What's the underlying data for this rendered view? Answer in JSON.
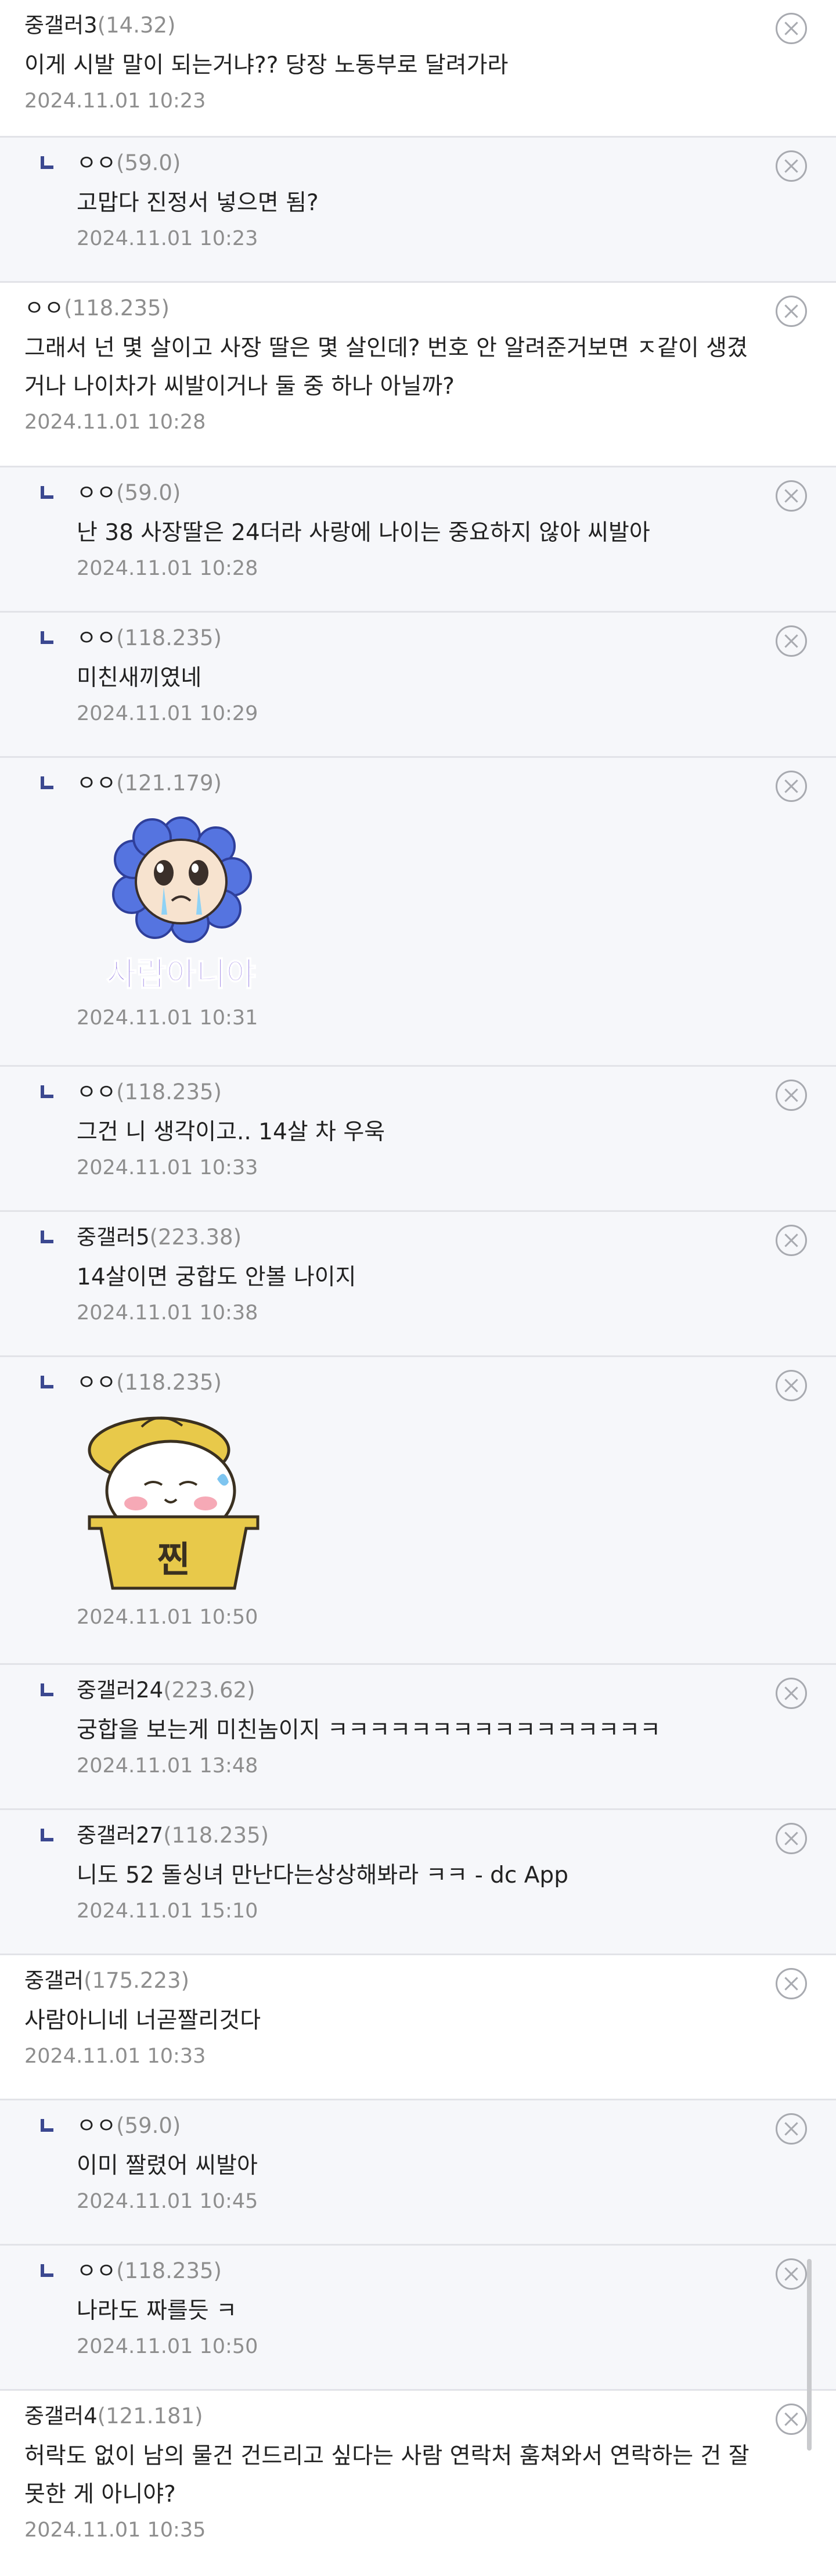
{
  "comments": [
    {
      "type": "comment",
      "nick": "중갤러3",
      "ip": "(14.32)",
      "text": "이게 시발 말이 되는거냐?? 당장 노동부로 달려가라",
      "date": "2024.11.01 10:23"
    },
    {
      "type": "reply",
      "nick": "ㅇㅇ",
      "ip": "(59.0)",
      "text": "고맙다 진정서 넣으면 됨?",
      "date": "2024.11.01 10:23"
    },
    {
      "type": "comment",
      "nick": "ㅇㅇ",
      "ip": "(118.235)",
      "text": "그래서 넌 몇 살이고 사장 딸은 몇 살인데? 번호 안 알려준거보면 ㅈ같이 생겼거나 나이차가 씨발이거나 둘 중 하나 아닐까?",
      "date": "2024.11.01 10:28"
    },
    {
      "type": "reply",
      "nick": "ㅇㅇ",
      "ip": "(59.0)",
      "text": "난 38 사장딸은 24더라 사랑에 나이는 중요하지 않아 씨발아",
      "date": "2024.11.01 10:28"
    },
    {
      "type": "reply",
      "nick": "ㅇㅇ",
      "ip": "(118.235)",
      "text": "미친새끼였네",
      "date": "2024.11.01 10:29"
    },
    {
      "type": "reply",
      "nick": "ㅇㅇ",
      "ip": "(121.179)",
      "sticker": "crying-flower-sticker",
      "sticker_text": "사람아니야",
      "date": "2024.11.01 10:31"
    },
    {
      "type": "reply",
      "nick": "ㅇㅇ",
      "ip": "(118.235)",
      "text": "그건 니 생각이고.. 14살 차 우욱",
      "date": "2024.11.01 10:33"
    },
    {
      "type": "reply",
      "nick": "중갤러5",
      "ip": "(223.38)",
      "text": "14살이면 궁합도 안볼 나이지",
      "date": "2024.11.01 10:38"
    },
    {
      "type": "reply",
      "nick": "ㅇㅇ",
      "ip": "(118.235)",
      "sticker": "steamed-bun-sticker",
      "sticker_text": "찐",
      "date": "2024.11.01 10:50"
    },
    {
      "type": "reply",
      "nick": "중갤러24",
      "ip": "(223.62)",
      "text": "궁합을 보는게 미친놈이지 ㅋㅋㅋㅋㅋㅋㅋㅋㅋㅋㅋㅋㅋㅋㅋㅋ",
      "date": "2024.11.01 13:48"
    },
    {
      "type": "reply",
      "nick": "중갤러27",
      "ip": "(118.235)",
      "text": "니도 52 돌싱녀 만난다는상상해봐라 ㅋㅋ - dc App",
      "date": "2024.11.01 15:10"
    },
    {
      "type": "comment",
      "nick": "중갤러",
      "ip": "(175.223)",
      "text": "사람아니네 너곧짤리것다",
      "date": "2024.11.01 10:33"
    },
    {
      "type": "reply",
      "nick": "ㅇㅇ",
      "ip": "(59.0)",
      "text": "이미 짤렸어 씨발아",
      "date": "2024.11.01 10:45"
    },
    {
      "type": "reply",
      "nick": "ㅇㅇ",
      "ip": "(118.235)",
      "text": "나라도 짜를듯 ㅋ",
      "date": "2024.11.01 10:50"
    },
    {
      "type": "comment",
      "nick": "중갤러4",
      "ip": "(121.181)",
      "text": "허락도 없이 남의 물건 건드리고 싶다는 사람 연락처 훔쳐와서 연락하는 건 잘못한 게 아니야?",
      "date": "2024.11.01 10:35"
    }
  ]
}
